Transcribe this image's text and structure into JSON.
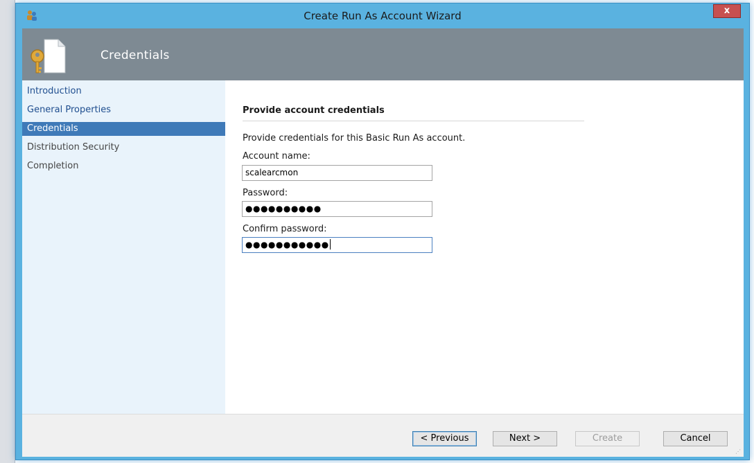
{
  "window": {
    "title": "Create Run As Account Wizard",
    "close_glyph": "x"
  },
  "header": {
    "title": "Credentials",
    "icon": "key-document-icon"
  },
  "sidebar": {
    "items": [
      {
        "label": "Introduction",
        "state": "done"
      },
      {
        "label": "General Properties",
        "state": "done"
      },
      {
        "label": "Credentials",
        "state": "active"
      },
      {
        "label": "Distribution Security",
        "state": "todo"
      },
      {
        "label": "Completion",
        "state": "todo"
      }
    ]
  },
  "main": {
    "section_title": "Provide account credentials",
    "description": "Provide credentials for this Basic Run As account.",
    "fields": {
      "account_name": {
        "label": "Account name:",
        "value": "scalearcmon"
      },
      "password": {
        "label": "Password:",
        "value": "●●●●●●●●●●"
      },
      "confirm_password": {
        "label": "Confirm password:",
        "value": "●●●●●●●●●●●"
      }
    }
  },
  "footer": {
    "previous_label": "< Previous",
    "next_label": "Next >",
    "create_label": "Create",
    "cancel_label": "Cancel"
  },
  "colors": {
    "titlebar": "#5ab2e0",
    "header": "#7e8a93",
    "sidebar": "#e9f3fb",
    "active_item": "#3f7ab8",
    "close_button": "#c75050"
  }
}
